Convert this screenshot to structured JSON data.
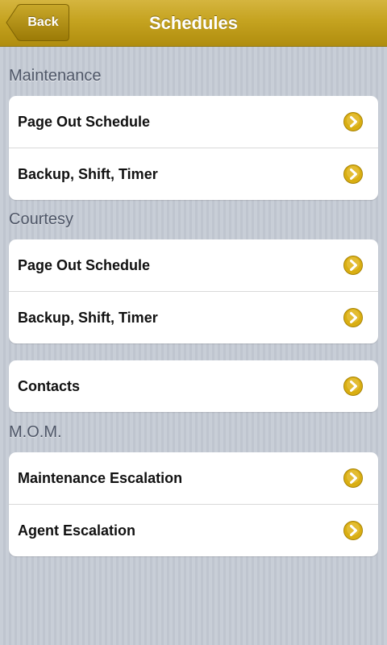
{
  "header": {
    "title": "Schedules",
    "back_label": "Back"
  },
  "sections": [
    {
      "title": "Maintenance",
      "items": [
        {
          "label": "Page Out Schedule",
          "icon": "chevron-right-icon"
        },
        {
          "label": "Backup, Shift, Timer",
          "icon": "chevron-right-icon"
        }
      ]
    },
    {
      "title": "Courtesy",
      "items": [
        {
          "label": "Page Out Schedule",
          "icon": "chevron-right-icon"
        },
        {
          "label": "Backup, Shift, Timer",
          "icon": "chevron-right-icon"
        }
      ]
    },
    {
      "title": "",
      "items": [
        {
          "label": "Contacts",
          "icon": "chevron-right-icon"
        }
      ]
    },
    {
      "title": "M.O.M.",
      "items": [
        {
          "label": "Maintenance Escalation",
          "icon": "chevron-right-icon"
        },
        {
          "label": "Agent Escalation",
          "icon": "chevron-right-icon"
        }
      ]
    }
  ],
  "colors": {
    "navbar_gold": "#c5a320",
    "chevron_gold": "#d9ae12",
    "section_text": "#4e5667",
    "background": "#c5cbd4"
  }
}
